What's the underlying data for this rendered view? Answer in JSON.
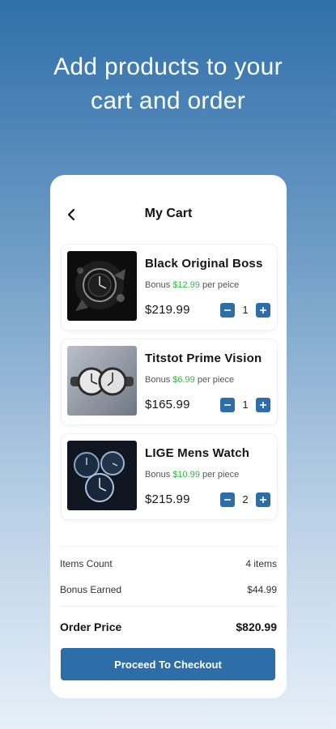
{
  "headline": {
    "line1": "Add products to your",
    "line2": "cart and order"
  },
  "cart": {
    "title": "My Cart",
    "items": [
      {
        "name": "Black Original Boss",
        "bonus_prefix": "Bonus ",
        "bonus_amount": "$12.99",
        "bonus_suffix": " per peice",
        "price": "$219.99",
        "qty": "1"
      },
      {
        "name": "Titstot Prime Vision",
        "bonus_prefix": "Bonus ",
        "bonus_amount": "$6.99",
        "bonus_suffix": " per piece",
        "price": "$165.99",
        "qty": "1"
      },
      {
        "name": "LIGE Mens Watch",
        "bonus_prefix": "Bonus ",
        "bonus_amount": "$10.99",
        "bonus_suffix": " per piece",
        "price": "$215.99",
        "qty": "2"
      }
    ]
  },
  "summary": {
    "items_count_label": "Items Count",
    "items_count_value": "4 items",
    "bonus_label": "Bonus Earned",
    "bonus_value": "$44.99",
    "order_label": "Order Price",
    "order_value": "$820.99"
  },
  "checkout_label": "Proceed To Checkout",
  "colors": {
    "accent": "#2d6ea8",
    "bonus_green": "#3bb44a"
  }
}
